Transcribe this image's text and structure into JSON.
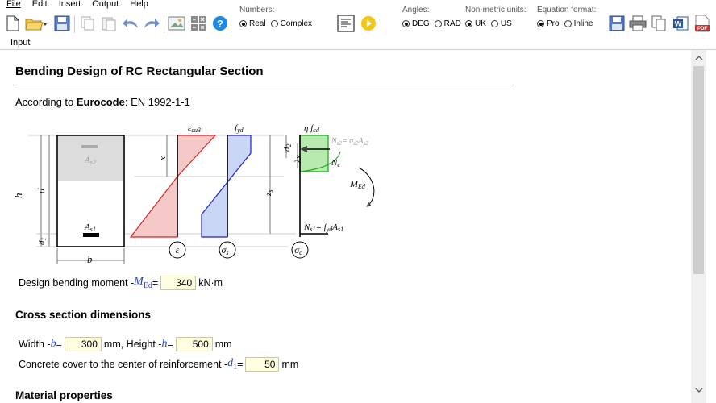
{
  "menu": {
    "file": "File",
    "edit": "Edit",
    "insert": "Insert",
    "output": "Output",
    "help": "Help"
  },
  "toolbar": {
    "numbers": {
      "title": "Numbers:",
      "opt1": "Real",
      "opt2": "Complex",
      "selected": "Real"
    },
    "angles": {
      "title": "Angles:",
      "opt1": "DEG",
      "opt2": "RAD",
      "selected": "DEG"
    },
    "units": {
      "title": "Non-metric units:",
      "opt1": "UK",
      "opt2": "US",
      "selected": "UK"
    },
    "equation": {
      "title": "Equation format:",
      "opt1": "Pro",
      "opt2": "Inline",
      "selected": "Pro"
    },
    "help_glyph": "?",
    "word_glyph": "W",
    "pdf_glyph": "PDF"
  },
  "tabs": {
    "input": "Input"
  },
  "doc": {
    "title": "Bending Design of RC Rectangular Section",
    "according_prefix": "According to ",
    "according_bold": "Eurocode",
    "according_suffix": ": EN 1992-1-1",
    "diagram": {
      "eps_cu3": "ε",
      "eps_cu3_sub": "cu3",
      "f_yd": "f",
      "f_yd_sub": "yd",
      "eta_fcd": "η f",
      "eta_fcd_sub": "cd",
      "ns2_label": "N",
      "ns2_sub": "s2",
      "ns2_rhs": "= σ",
      "ns2_rhs_sub": "s2",
      "ns2_A": "A",
      "ns2_A_sub": "s2",
      "as2": "A",
      "as2_sub": "s2",
      "as1": "A",
      "as1_sub": "s1",
      "h": "h",
      "d": "d",
      "d1": "d",
      "d1_sub": "1",
      "b": "b",
      "x": "x",
      "d2": "d",
      "d2_sub": "2",
      "lx": "λx",
      "zs": "z",
      "zs_sub": "s",
      "nc": "N",
      "nc_sub": "c",
      "med": "M",
      "med_sub": "Ed",
      "ns1": "N",
      "ns1_sub": "s1",
      "ns1_rhs": "= f",
      "ns1_rhs_sub": "yd",
      "ns1_A": "A",
      "ns1_A_sub": "s1",
      "circle_eps": "ε",
      "circle_sigma_s": "σ",
      "circle_sigma_s_sub": "s",
      "circle_sigma_c": "σ",
      "circle_sigma_c_sub": "c"
    },
    "moment": {
      "label": "Design bending moment - ",
      "var": "M",
      "var_sub": "Ed",
      "eq": " = ",
      "value": "340",
      "unit": "kN·m"
    },
    "cross_section_heading": "Cross section dimensions",
    "width": {
      "label": "Width - ",
      "var": "b",
      "eq": " = ",
      "value": "300",
      "unit": "mm, Height - ",
      "var2": "h",
      "eq2": " = ",
      "value2": "500",
      "unit2": "mm"
    },
    "cover": {
      "label": "Concrete cover to the center of reinforcement - ",
      "var": "d",
      "var_sub": "1",
      "eq": " = ",
      "value": "50",
      "unit": "mm"
    },
    "material_heading": "Material properties"
  }
}
